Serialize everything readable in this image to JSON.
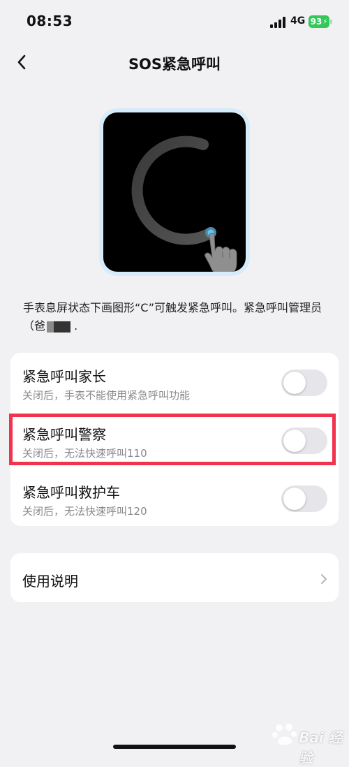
{
  "status_bar": {
    "time": "08:53",
    "network": "4G",
    "battery": "93"
  },
  "header": {
    "title": "SOS紧急呼叫"
  },
  "description": {
    "text": "手表息屏状态下画图形“C”可触发紧急呼叫。紧急呼叫管理员（爸",
    "trailing": "."
  },
  "settings": [
    {
      "title": "紧急呼叫家长",
      "subtitle": "关闭后，手表不能使用紧急呼叫功能",
      "enabled": false
    },
    {
      "title": "紧急呼叫警察",
      "subtitle": "关闭后，无法快速呼叫110",
      "enabled": false
    },
    {
      "title": "紧急呼叫救护车",
      "subtitle": "关闭后，无法快速呼叫120",
      "enabled": false
    }
  ],
  "instructions": {
    "label": "使用说明"
  },
  "watermark": {
    "text": "Bai 经验"
  },
  "colors": {
    "background": "#f1f1f3",
    "battery": "#33c859",
    "highlight": "#f2334e",
    "toggle_off": "#e5e5ea"
  }
}
